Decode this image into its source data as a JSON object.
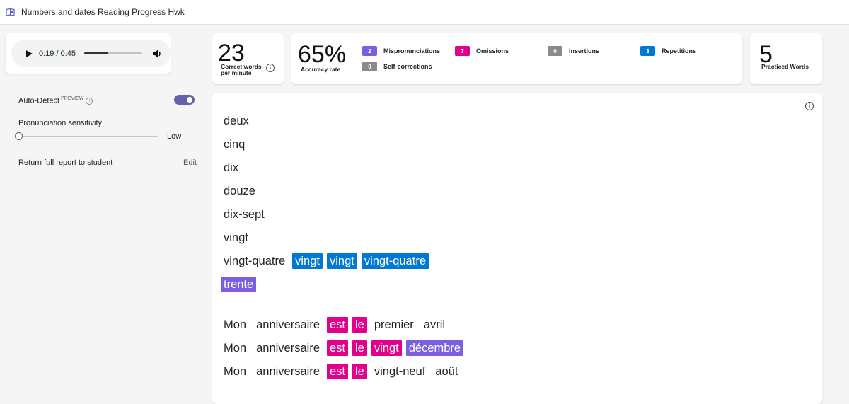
{
  "window": {
    "title": "Numbers and dates Reading Progress Hwk"
  },
  "audio": {
    "current_time": "0:19",
    "separator": " / ",
    "duration": "0:45",
    "progress": 0.42
  },
  "settings": {
    "auto_detect_label": "Auto-Detect",
    "preview_tag": "PREVIEW",
    "auto_detect_on": true,
    "sensitivity_label": "Pronunciation sensitivity",
    "sensitivity_value": "Low",
    "report_label": "Return full report to student",
    "edit_label": "Edit"
  },
  "metrics": {
    "wcpm": {
      "value": "23",
      "label_line1": "Correct words",
      "label_line2": "per minute"
    },
    "accuracy": {
      "value": "65%",
      "label": "Accuracy rate"
    },
    "errors": [
      {
        "count": "2",
        "label": "Mispronunciations",
        "color": "#7b5fe0"
      },
      {
        "count": "7",
        "label": "Omissions",
        "color": "#e3008c"
      },
      {
        "count": "0",
        "label": "Insertions",
        "color": "#8a8a8a"
      },
      {
        "count": "3",
        "label": "Repetitions",
        "color": "#0078d4"
      },
      {
        "count": "0",
        "label": "Self-corrections",
        "color": "#8a8a8a"
      }
    ],
    "practiced": {
      "value": "5",
      "label": "Practiced Words"
    }
  },
  "passage": {
    "lines": [
      [
        {
          "t": "deux",
          "s": "normal"
        }
      ],
      [
        {
          "t": "cinq",
          "s": "normal"
        }
      ],
      [
        {
          "t": "dix",
          "s": "normal"
        }
      ],
      [
        {
          "t": "douze",
          "s": "normal"
        }
      ],
      [
        {
          "t": "dix-sept",
          "s": "normal"
        }
      ],
      [
        {
          "t": "vingt",
          "s": "normal"
        }
      ],
      [
        {
          "t": "vingt-quatre",
          "s": "normal"
        },
        {
          "t": "vingt",
          "s": "repetition"
        },
        {
          "t": "vingt",
          "s": "repetition"
        },
        {
          "t": "vingt-quatre",
          "s": "repetition"
        }
      ],
      [
        {
          "t": "trente",
          "s": "mispronunciation"
        }
      ],
      [
        {
          "t": "Mon",
          "s": "normal"
        },
        {
          "t": "anniversaire",
          "s": "normal"
        },
        {
          "t": "est",
          "s": "omission"
        },
        {
          "t": "le",
          "s": "omission"
        },
        {
          "t": "premier",
          "s": "normal"
        },
        {
          "t": "avril",
          "s": "normal"
        }
      ],
      [
        {
          "t": "Mon",
          "s": "normal"
        },
        {
          "t": "anniversaire",
          "s": "normal"
        },
        {
          "t": "est",
          "s": "omission"
        },
        {
          "t": "le",
          "s": "omission"
        },
        {
          "t": "vingt",
          "s": "omission"
        },
        {
          "t": "décembre",
          "s": "mispronunciation"
        }
      ],
      [
        {
          "t": "Mon",
          "s": "normal"
        },
        {
          "t": "anniversaire",
          "s": "normal"
        },
        {
          "t": "est",
          "s": "omission"
        },
        {
          "t": "le",
          "s": "omission"
        },
        {
          "t": "vingt-neuf",
          "s": "normal"
        },
        {
          "t": "août",
          "s": "normal"
        }
      ]
    ]
  }
}
